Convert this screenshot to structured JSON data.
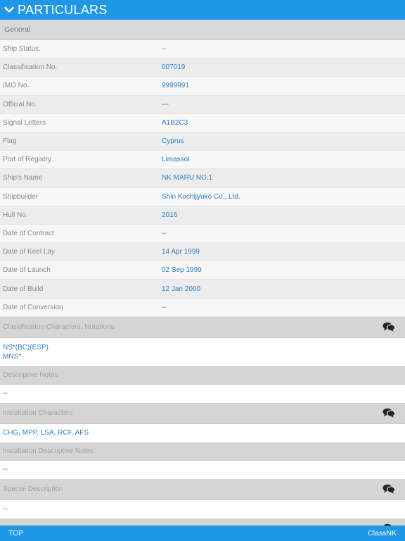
{
  "header": {
    "title": "PARTICULARS"
  },
  "general": {
    "title": "General",
    "rows": [
      {
        "label": "Ship Status.",
        "value": "--"
      },
      {
        "label": "Classification No.",
        "value": "007019"
      },
      {
        "label": "IMO No.",
        "value": "9999991"
      },
      {
        "label": "Official No.",
        "value": "---"
      },
      {
        "label": "Signal Letters",
        "value": "A1B2C3"
      },
      {
        "label": "Flag",
        "value": "Cyprus"
      },
      {
        "label": "Port of Registry",
        "value": "Limassol"
      },
      {
        "label": "Ship's Name",
        "value": "NK MARU NO.1"
      },
      {
        "label": "Shipbuilder",
        "value": "Shin Kochijyuko Co., Ltd."
      },
      {
        "label": "Hull No.",
        "value": "2016"
      },
      {
        "label": "Date of Contract",
        "value": "--"
      },
      {
        "label": "Date of Keel Lay",
        "value": "14 Apr 1999"
      },
      {
        "label": "Date of Launch",
        "value": "02 Sep 1999"
      },
      {
        "label": "Date of Build",
        "value": "12 Jan 2000"
      },
      {
        "label": "Date of Conversion",
        "value": "--"
      }
    ]
  },
  "class_characters": {
    "title": "Classification Characters, Notations",
    "lines": [
      "NS*(BC)(ESP)",
      "MNS*"
    ]
  },
  "descriptive_notes": {
    "title": "Descriptive Notes",
    "value": "--"
  },
  "installation_characters": {
    "title": "Installation Characters",
    "value": "CHG, MPP, LSA, RCF, AFS"
  },
  "installation_descriptive_notes": {
    "title": "Installation Descriptive Notes",
    "value": "--"
  },
  "special_description": {
    "title": "Special Description",
    "value": "--"
  },
  "footer": {
    "top_label": "TOP",
    "brand_label": "ClassNK"
  },
  "colors": {
    "accent": "#1e98e6",
    "value_text": "#2d7fc7"
  },
  "icons": {
    "header": "chevron-down-icon",
    "comment": "chat-bubbles-icon"
  }
}
